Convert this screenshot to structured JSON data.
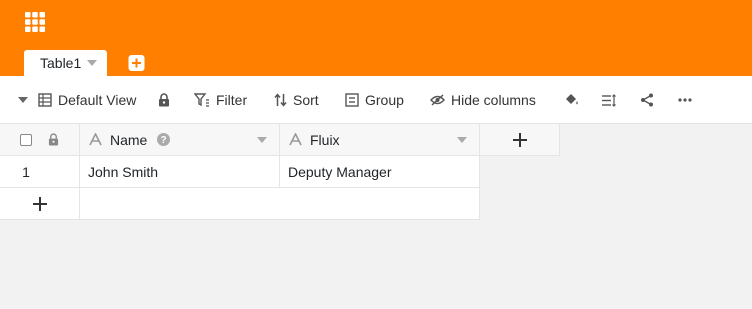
{
  "header": {
    "brand_color": "#ff8000",
    "apps_icon": "grid-apps-icon",
    "tabs": [
      {
        "label": "Table1"
      }
    ],
    "add_table_icon": "plus-square-icon"
  },
  "toolbar": {
    "view_name": "Default View",
    "filter_label": "Filter",
    "sort_label": "Sort",
    "group_label": "Group",
    "hide_columns_label": "Hide columns"
  },
  "table": {
    "columns": [
      {
        "title": "Name"
      },
      {
        "title": "Fluix"
      }
    ],
    "rows": [
      {
        "number": "1",
        "cells": [
          "John Smith",
          "Deputy Manager"
        ]
      }
    ]
  }
}
